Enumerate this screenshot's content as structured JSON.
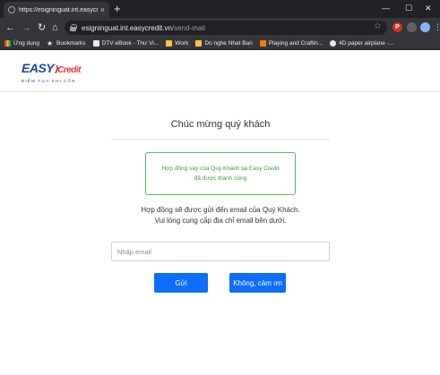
{
  "browser": {
    "tab_title": "https://esigninguat.int.easycredit",
    "tab_close": "×",
    "new_tab": "+",
    "window_controls": {
      "minimize": "—",
      "maximize": "☐",
      "close": "✕"
    },
    "nav": {
      "back": "←",
      "forward": "→",
      "reload": "↻",
      "home": "⌂"
    },
    "url_host": "esigninguat.int.easycredit.vn",
    "url_path": "/send-mail",
    "star": "☆",
    "extension_label": "P",
    "menu": "⋮",
    "bookmarks": [
      {
        "label": "Ứng dụng",
        "icon": "apps-icon"
      },
      {
        "label": "Bookmarks",
        "icon": "star-icon"
      },
      {
        "label": "DTV eBook - Thư Vi...",
        "icon": "page-icon"
      },
      {
        "label": "Work",
        "icon": "folder-icon"
      },
      {
        "label": "Do nghe Nhat Ban",
        "icon": "folder-icon"
      },
      {
        "label": "Playing and Craftin...",
        "icon": "blogger-icon"
      },
      {
        "label": "4D paper airplane -...",
        "icon": "globe-icon"
      }
    ]
  },
  "site": {
    "logo_easy": "EASY",
    "logo_credit": "Credit",
    "logo_tagline": "ĐIỂM TỰA KHI CẦN"
  },
  "page": {
    "heading": "Chúc mừng quý khách",
    "alert": {
      "line1": "Hợp đồng vay của Quý Khách tại Easy Credit",
      "line2": "đã được thành công"
    },
    "info_line1": "Hợp đồng sẽ được gửi đến email của Quý Khách.",
    "info_line2": "Vui lòng cung cấp địa chỉ email bên dưới.",
    "email_placeholder": "Nhập email",
    "send_label": "Gửi",
    "decline_label": "Không, cảm ơn"
  },
  "colors": {
    "primary": "#0d6efd",
    "success_border": "#5cb85c",
    "brand_blue": "#17479e",
    "brand_red": "#e03a3e"
  }
}
